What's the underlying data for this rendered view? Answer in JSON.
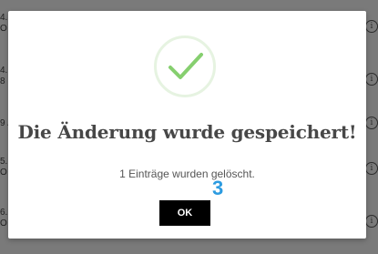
{
  "background_rows": [
    {
      "text": "4.\nO"
    },
    {
      "text": "4.\n8"
    },
    {
      "text": "9 /"
    },
    {
      "text": "5.\nO"
    },
    {
      "text": "6.\nO"
    }
  ],
  "info_icon_glyph": "i",
  "dialog": {
    "icon": "checkmark-icon",
    "title": "Die Änderung wurde gespeichert!",
    "message": "1 Einträge wurden gelöscht.",
    "badge": "3",
    "ok_label": "OK"
  },
  "colors": {
    "check": "#86cf6f",
    "check_ring": "#e6f3e1",
    "badge": "#2c9be0",
    "button_bg": "#000000",
    "button_text": "#ffffff"
  }
}
